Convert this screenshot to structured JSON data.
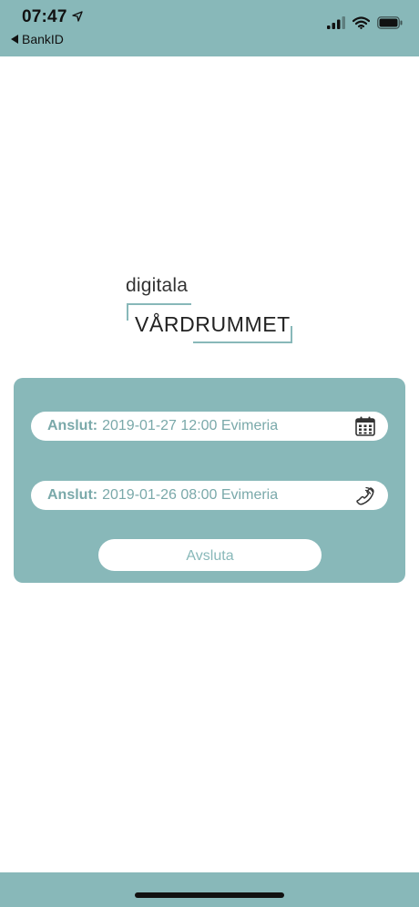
{
  "status_bar": {
    "time": "07:47",
    "back_label": "BankID",
    "icons": [
      "location-arrow-icon",
      "signal-icon",
      "wifi-icon",
      "battery-icon"
    ]
  },
  "logo": {
    "line1": "digitala",
    "line2": "VÅRDRUMMET"
  },
  "appointments": [
    {
      "label": "Anslut:",
      "value": "2019-01-27 12:00 Evimeria",
      "icon": "calendar-icon"
    },
    {
      "label": "Anslut:",
      "value": "2019-01-26 08:00 Evimeria",
      "icon": "phone-icon"
    }
  ],
  "end_button": {
    "label": "Avsluta"
  },
  "colors": {
    "brand": "#88b8b9",
    "text_accent": "#7aa9aa"
  }
}
